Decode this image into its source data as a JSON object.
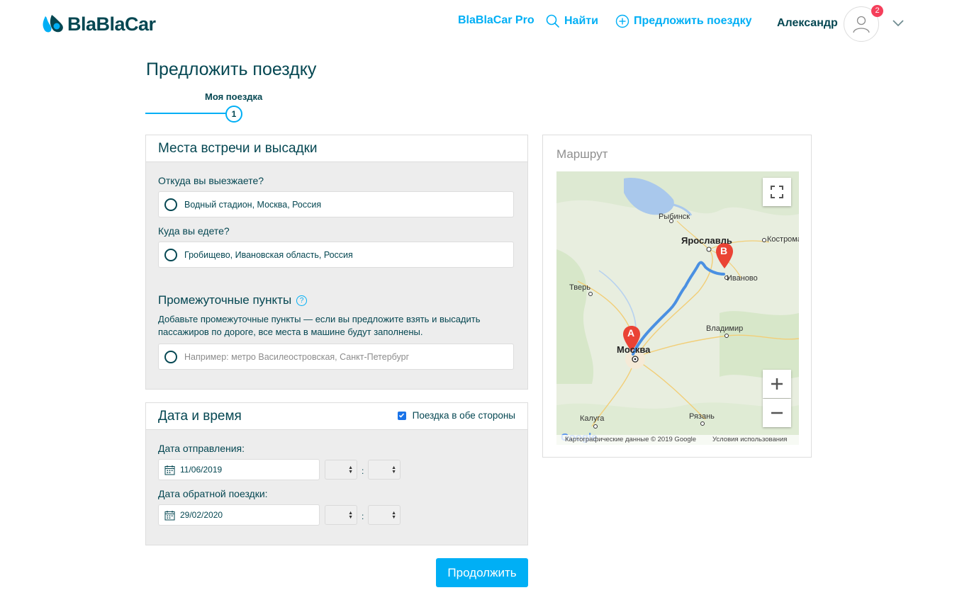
{
  "header": {
    "logo_text": "BlaBlaCar",
    "nav": {
      "pro": "BlaBlaCar Pro",
      "find": "Найти",
      "offer": "Предложить поездку"
    },
    "user_name": "Александр",
    "notification_count": "2"
  },
  "page": {
    "title": "Предложить поездку",
    "step_label": "Моя поездка",
    "step_number": "1"
  },
  "places": {
    "title": "Места встречи и высадки",
    "from_label": "Откуда вы выезжаете?",
    "from_value": "Водный стадион, Москва, Россия",
    "to_label": "Куда вы едете?",
    "to_value": "Гробищево, Ивановская область, Россия",
    "waypoints_title": "Промежуточные пункты",
    "help_symbol": "?",
    "waypoints_desc": "Добавьте промежуточные пункты — если вы предложите взять и высадить пассажиров по дороге, все места в машине будут заполнены.",
    "waypoint_placeholder": "Например: метро Василеостровская, Санкт-Петербург"
  },
  "datetime": {
    "title": "Дата и время",
    "round_trip_label": "Поездка в обе стороны",
    "round_trip_checked": true,
    "departure_label": "Дата отправления:",
    "departure_date": "11/06/2019",
    "return_label": "Дата обратной поездки:",
    "return_date": "29/02/2020",
    "colon": ":"
  },
  "continue_label": "Продолжить",
  "map": {
    "title": "Маршрут",
    "cities": {
      "rybinsk": "Рыбинск",
      "yaroslavl": "Ярославль",
      "kostroma": "Кострома",
      "ivanovo": "Иваново",
      "tver": "Тверь",
      "vladimir": "Владимир",
      "moskva": "Москва",
      "kaluga": "Калуга",
      "ryazan": "Рязань"
    },
    "marker_a": "A",
    "marker_b": "B",
    "copyright": "Картографические данные © 2019 Google",
    "terms": "Условия использования",
    "google_logo": "Google"
  },
  "colors": {
    "brand": "#00aff5",
    "text": "#054752",
    "route": "#4a90e2",
    "marker": "#ea4335"
  }
}
